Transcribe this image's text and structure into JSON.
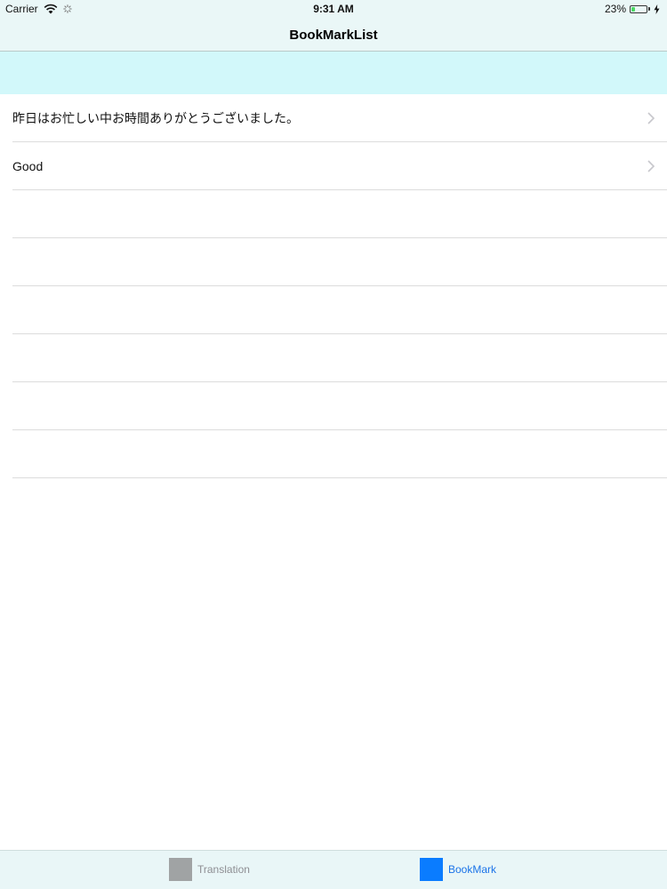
{
  "status_bar": {
    "carrier": "Carrier",
    "time": "9:31 AM",
    "battery_percent": "23%",
    "battery_level": 0.23,
    "icons": [
      "wifi-icon",
      "activity-spinner-icon",
      "battery-icon",
      "charging-bolt-icon"
    ]
  },
  "nav": {
    "title": "BookMarkList"
  },
  "list": {
    "items": [
      {
        "label": "昨日はお忙しい中お時間ありがとうございました。",
        "has_chevron": true
      },
      {
        "label": "Good",
        "has_chevron": true
      },
      {
        "label": "",
        "has_chevron": false
      },
      {
        "label": "",
        "has_chevron": false
      },
      {
        "label": "",
        "has_chevron": false
      },
      {
        "label": "",
        "has_chevron": false
      },
      {
        "label": "",
        "has_chevron": false
      },
      {
        "label": "",
        "has_chevron": false
      }
    ]
  },
  "tabbar": {
    "tabs": [
      {
        "label": "Translation",
        "selected": false
      },
      {
        "label": "BookMark",
        "selected": true
      }
    ]
  },
  "colors": {
    "band": "#d2f8fa",
    "selected_tab": "#0a7cff",
    "unselected_tab": "#a0a3a4"
  }
}
